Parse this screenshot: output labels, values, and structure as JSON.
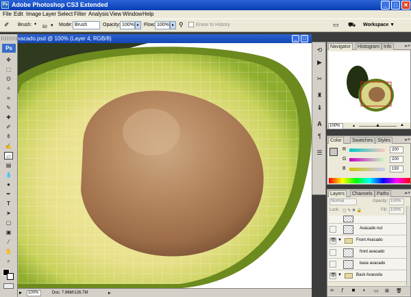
{
  "app": {
    "title": "Adobe Photoshop CS3 Extended",
    "logo": "Ps"
  },
  "menu": [
    "File",
    "Edit",
    "Image",
    "Layer",
    "Select",
    "Filter",
    "Analysis",
    "View",
    "Window",
    "Help"
  ],
  "options": {
    "brush_label": "Brush:",
    "brush_size": "50",
    "mode_label": "Mode:",
    "mode_value": "Brush",
    "opacity_label": "Opacity:",
    "opacity_value": "100%",
    "flow_label": "Flow:",
    "flow_value": "100%",
    "erase_history": "Erase to History",
    "workspace_label": "Workspace ▼"
  },
  "document": {
    "title": "vacado.psd @ 100% (Layer 4, RGB/8)",
    "zoom": "100%",
    "doc_size": "Doc: 7.96M/126.7M"
  },
  "navigator": {
    "tabs": [
      "Navigator",
      "Histogram",
      "Info"
    ],
    "zoom": "100%"
  },
  "color": {
    "tabs": [
      "Color",
      "Swatches",
      "Styles"
    ],
    "channels": [
      {
        "name": "R",
        "value": "200"
      },
      {
        "name": "G",
        "value": "200"
      },
      {
        "name": "B",
        "value": "193"
      }
    ],
    "foreground": "#c8c8c1"
  },
  "layers": {
    "tabs": [
      "Layers",
      "Channels",
      "Paths"
    ],
    "blend_mode": "Normal",
    "opacity_label": "Opacity:",
    "opacity_value": "100%",
    "lock_label": "Lock:",
    "fill_label": "Fill:",
    "fill_value": "100%",
    "rows": [
      {
        "name": "Avacado nut",
        "type": "layer",
        "visible": false
      },
      {
        "name": "Front Avacado",
        "type": "group",
        "visible": true
      },
      {
        "name": "front avacado",
        "type": "layer",
        "visible": false
      },
      {
        "name": "base avacado",
        "type": "layer",
        "visible": false
      },
      {
        "name": "Back Avacoda",
        "type": "group",
        "visible": true
      }
    ]
  }
}
